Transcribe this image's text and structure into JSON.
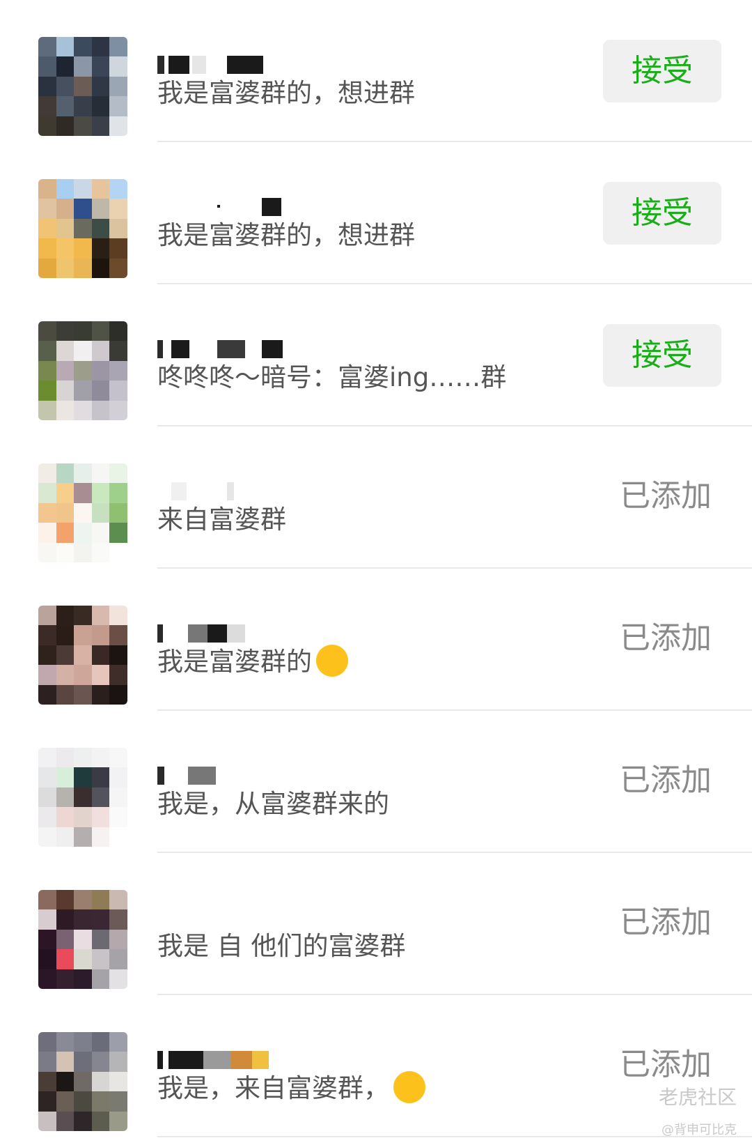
{
  "requests": [
    {
      "message": "我是富婆群的，想进群",
      "status": "accept",
      "action_label": "接受",
      "palette": [
        "#5d6b7d",
        "#a7c1d9",
        "#3b4a5c",
        "#2d3544",
        "#7f8fa3",
        "#4c5a6b",
        "#1e2530",
        "#8b96a6",
        "#3a4556",
        "#cfd6de",
        "#2a3240",
        "#46505f",
        "#6b5c55",
        "#303846",
        "#9aa6b4",
        "#423a36",
        "#55606e",
        "#383f4b",
        "#272d36",
        "#b4bcc7",
        "#3f3a2f",
        "#2f2a24",
        "#4b4a44",
        "#3a3f49",
        "#e0e3e8"
      ]
    },
    {
      "message": "我是富婆群的，想进群",
      "status": "accept",
      "action_label": "接受",
      "palette": [
        "#d9b48a",
        "#a9cff0",
        "#c9d7e6",
        "#e6c59c",
        "#b3d4f3",
        "#e0c4a2",
        "#d5b08a",
        "#2e4f8c",
        "#bfb7a8",
        "#ead2b1",
        "#f0c474",
        "#e2c48f",
        "#6a6a5e",
        "#3d4d45",
        "#dcc39f",
        "#f1b94c",
        "#f5c466",
        "#f1b94c",
        "#2a1f14",
        "#5c3d22",
        "#e3a93f",
        "#eec46c",
        "#e9b555",
        "#1c140d",
        "#6d4a2a"
      ]
    },
    {
      "message": "咚咚咚～暗号：富婆ing……群",
      "status": "accept",
      "action_label": "接受",
      "palette": [
        "#4b4b3f",
        "#3c3d36",
        "#383c32",
        "#4f5346",
        "#2e2e28",
        "#58604c",
        "#dcd6d5",
        "#f1efef",
        "#cfc8cc",
        "#3b3b35",
        "#78884f",
        "#b9a9b5",
        "#9c9d8b",
        "#9c95a4",
        "#a9a5b2",
        "#6b8d2f",
        "#d8d4d4",
        "#a1a0a8",
        "#8f8b9a",
        "#c4c0cc",
        "#c3c6ad",
        "#ebe6e2",
        "#e0dcdf",
        "#c6c3cb",
        "#d2cfd6"
      ]
    },
    {
      "message": "来自富婆群",
      "status": "added",
      "action_label": "已添加",
      "palette": [
        "#f2ece6",
        "#b8d6c4",
        "#e6efe9",
        "#f6f6f4",
        "#e9f4e7",
        "#d9e8d1",
        "#f7cf8a",
        "#a88d93",
        "#c9e8bd",
        "#9fd08b",
        "#f3c58f",
        "#f0c58c",
        "#fbf6ef",
        "#c7e0bf",
        "#8fc06f",
        "#fdf2e9",
        "#f4a26b",
        "#eef4ef",
        "#f7f7f3",
        "#5c8f4f",
        "#f9f7f3",
        "#fdfbf7",
        "#f3f3f0",
        "#fafaf8",
        "#ffffff"
      ]
    },
    {
      "message": "我是富婆群的",
      "status": "added",
      "action_label": "已添加",
      "palette": [
        "#b9a39b",
        "#2c1f19",
        "#3a2a24",
        "#d8b9ad",
        "#f2e3dd",
        "#3b2a25",
        "#2a1c17",
        "#c9a293",
        "#c29b8d",
        "#6b4f46",
        "#2f211c",
        "#4b3a35",
        "#d8b2a4",
        "#3a2824",
        "#1c1411",
        "#c1a7ae",
        "#d3b1a5",
        "#cfa69a",
        "#e6c6bc",
        "#3e2d29",
        "#2c2020",
        "#5a4541",
        "#6a5550",
        "#2a1f1d",
        "#1a1311"
      ]
    },
    {
      "message": "我是，从富婆群来的",
      "status": "added",
      "action_label": "已添加",
      "palette": [
        "#f1f0f2",
        "#eceaec",
        "#eef0ef",
        "#f3f3f4",
        "#f7f7f8",
        "#e5e7e9",
        "#d7efd9",
        "#1f3b3b",
        "#3b3b45",
        "#f2f2f4",
        "#dcdcdd",
        "#b6b2ae",
        "#3a2f2e",
        "#53535b",
        "#f5f5f6",
        "#ebe9ec",
        "#eed7d3",
        "#e2d4cd",
        "#f0dfdc",
        "#fafafa",
        "#f4f4f5",
        "#efefef",
        "#b5aeae",
        "#f6f2f2",
        "#ffffff"
      ]
    },
    {
      "message": "我是 自 他们的富婆群",
      "status": "added",
      "action_label": "已添加",
      "palette": [
        "#8a6a5f",
        "#5a3a2f",
        "#9a7f6e",
        "#8f7c57",
        "#c9b9b0",
        "#d8ccd0",
        "#2e1a24",
        "#3a2631",
        "#3b2733",
        "#6b5a57",
        "#2c1525",
        "#7a6272",
        "#e9dde1",
        "#6b6a70",
        "#b4a8ad",
        "#231122",
        "#e94b5a",
        "#d9d9d0",
        "#c7c3c6",
        "#a6a3a8",
        "#2a1626",
        "#34202f",
        "#2c1b2a",
        "#a5a3a8",
        "#e3e1e3"
      ]
    },
    {
      "message": "我是，来自富婆群，",
      "status": "added",
      "action_label": "已添加",
      "palette": [
        "#6e6e7c",
        "#8a8a96",
        "#7d7f8c",
        "#6a6c7a",
        "#9c9eaa",
        "#7a7b86",
        "#d4c2b2",
        "#6d6e79",
        "#858690",
        "#b5b5b8",
        "#4a3d36",
        "#1c1717",
        "#6f6a66",
        "#d8d6d2",
        "#e7e6e3",
        "#2e2423",
        "#6b5e55",
        "#4c4a40",
        "#7b7a6a",
        "#7b7a70",
        "#c8bfc0",
        "#5a4e52",
        "#2e2629",
        "#5c5d4e",
        "#9a9a88"
      ]
    }
  ],
  "watermark": {
    "brand": "老虎社区",
    "handle": "@背申可比克"
  },
  "colors": {
    "accept_text": "#1aad19",
    "accept_bg": "#f0f0f0",
    "added_text": "#8a8a8a",
    "message_text": "#555555",
    "divider": "#e8e8e8"
  }
}
